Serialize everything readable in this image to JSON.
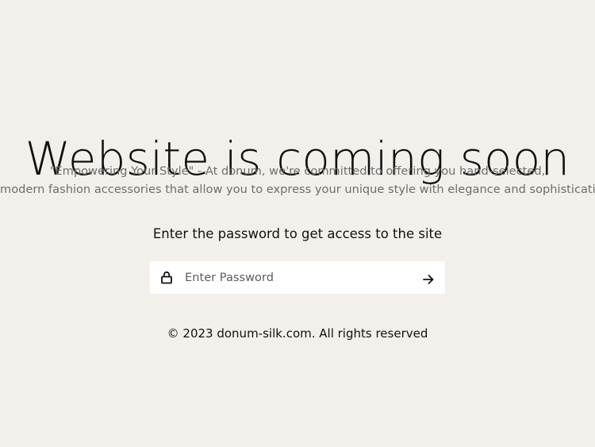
{
  "heading": "Website is coming soon",
  "tagline": {
    "line1": "\"Empowering Your Style\" - At donum, we're committed to offering you hand-selected,",
    "line2": "modern fashion accessories that allow you to express your unique style with elegance and sophistication."
  },
  "password": {
    "prompt": "Enter the password to get access to the site",
    "placeholder": "Enter Password",
    "value": "",
    "lock_icon": "lock-icon",
    "submit_icon": "arrow-right-icon"
  },
  "footer": {
    "text": "© 2023 donum-silk.com. All rights reserved"
  },
  "colors": {
    "background": "#f3f0eb",
    "text": "#111111",
    "muted_text": "#6e6e6e",
    "field_background": "#ffffff"
  }
}
